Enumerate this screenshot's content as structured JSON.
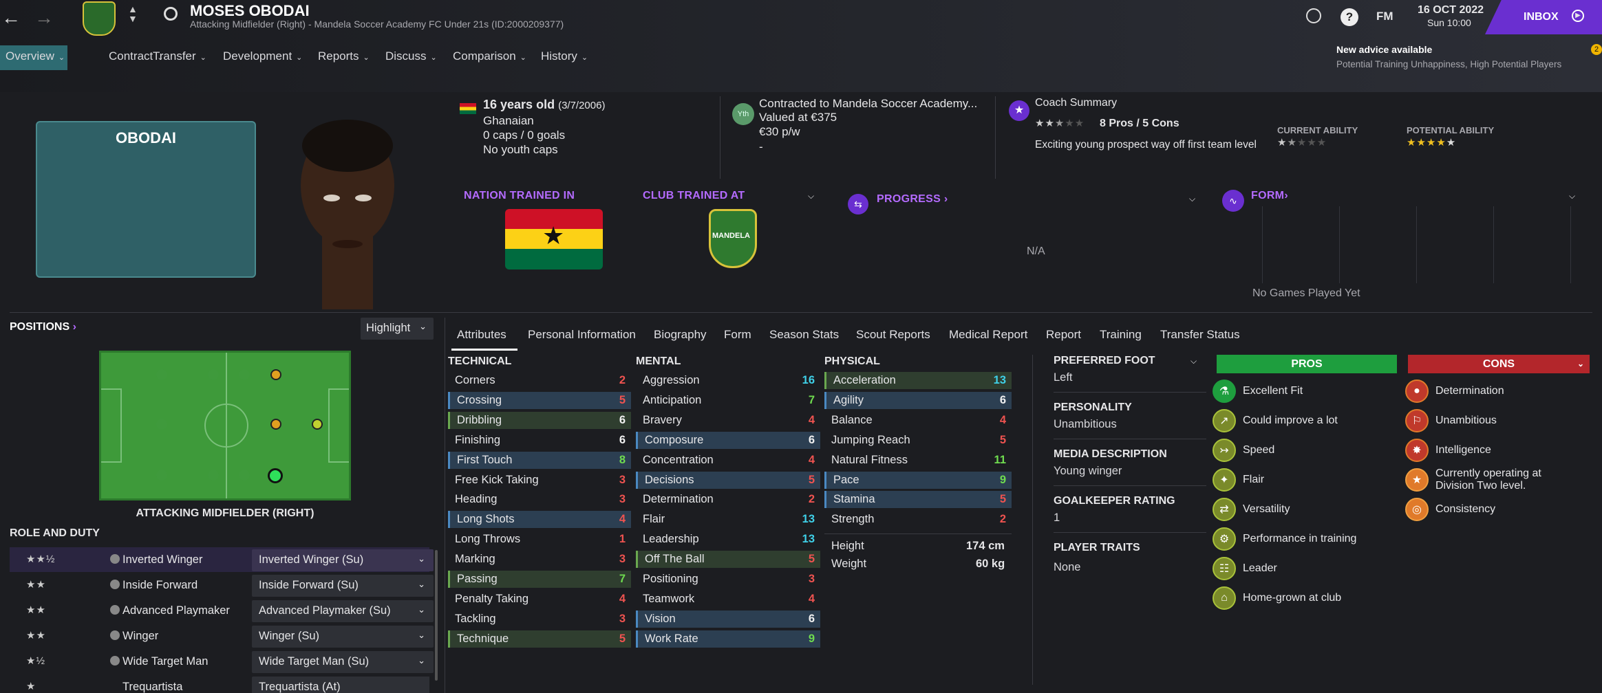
{
  "header": {
    "player_name": "MOSES OBODAI",
    "player_subtitle": "Attacking Midfielder (Right) - Mandela Soccer Academy FC Under 21s (ID:2000209377)",
    "date": "16 OCT 2022",
    "time": "Sun 10:00",
    "fm_label": "FM",
    "inbox_label": "INBOX",
    "inbox_count": "2",
    "advice_title": "New advice available",
    "advice_text": "Potential Training Unhappiness, High Potential Players"
  },
  "nav_tabs": [
    "Overview",
    "Contract",
    "Transfer",
    "Development",
    "Reports",
    "Discuss",
    "Comparison",
    "History"
  ],
  "profile": {
    "kit_name": "OBODAI",
    "age": "16 years old",
    "dob": "(3/7/2006)",
    "nationality": "Ghanaian",
    "caps": "0 caps / 0 goals",
    "youth_caps": "No youth caps",
    "yth_badge": "Yth",
    "contract": "Contracted to Mandela Soccer Academy...",
    "value": "Valued at €375",
    "wage": "€30 p/w",
    "contract_extra": "-",
    "coach_title": "Coach Summary",
    "pros_cons_summary": "8 Pros / 5 Cons",
    "coach_text": "Exciting young prospect way off first team level",
    "current_ability_label": "CURRENT ABILITY",
    "potential_ability_label": "POTENTIAL ABILITY",
    "current_ability_stars": 1.5,
    "potential_ability_stars": 4,
    "coach_stars": 2.5,
    "nation_trained_label": "NATION TRAINED IN",
    "club_trained_label": "CLUB TRAINED AT",
    "progress_label": "PROGRESS",
    "progress_value": "N/A",
    "form_label": "FORM",
    "form_empty": "No Games Played Yet",
    "club_badge_text": "MANDELA"
  },
  "positions": {
    "title": "POSITIONS",
    "highlight_label": "Highlight",
    "position_name": "ATTACKING MIDFIELDER (RIGHT)"
  },
  "roles": {
    "title": "ROLE AND DUTY",
    "items": [
      {
        "name": "Inverted Winger",
        "duty": "Inverted Winger (Su)",
        "stars": "★★½"
      },
      {
        "name": "Inside Forward",
        "duty": "Inside Forward (Su)",
        "stars": "★★"
      },
      {
        "name": "Advanced Playmaker",
        "duty": "Advanced Playmaker (Su)",
        "stars": "★★"
      },
      {
        "name": "Winger",
        "duty": "Winger (Su)",
        "stars": "★★"
      },
      {
        "name": "Wide Target Man",
        "duty": "Wide Target Man (Su)",
        "stars": "★½"
      },
      {
        "name": "Trequartista",
        "duty": "Trequartista (At)",
        "stars": "★"
      }
    ]
  },
  "sub_tabs": [
    "Attributes",
    "Personal Information",
    "Biography",
    "Form",
    "Season Stats",
    "Scout Reports",
    "Medical Report",
    "Report",
    "Training",
    "Transfer Status"
  ],
  "attributes": {
    "technical_title": "TECHNICAL",
    "mental_title": "MENTAL",
    "physical_title": "PHYSICAL",
    "technical": [
      {
        "name": "Corners",
        "value": "2"
      },
      {
        "name": "Crossing",
        "value": "5"
      },
      {
        "name": "Dribbling",
        "value": "6"
      },
      {
        "name": "Finishing",
        "value": "6"
      },
      {
        "name": "First Touch",
        "value": "8"
      },
      {
        "name": "Free Kick Taking",
        "value": "3"
      },
      {
        "name": "Heading",
        "value": "3"
      },
      {
        "name": "Long Shots",
        "value": "4"
      },
      {
        "name": "Long Throws",
        "value": "1"
      },
      {
        "name": "Marking",
        "value": "3"
      },
      {
        "name": "Passing",
        "value": "7"
      },
      {
        "name": "Penalty Taking",
        "value": "4"
      },
      {
        "name": "Tackling",
        "value": "3"
      },
      {
        "name": "Technique",
        "value": "5"
      }
    ],
    "mental": [
      {
        "name": "Aggression",
        "value": "16"
      },
      {
        "name": "Anticipation",
        "value": "7"
      },
      {
        "name": "Bravery",
        "value": "4"
      },
      {
        "name": "Composure",
        "value": "6"
      },
      {
        "name": "Concentration",
        "value": "4"
      },
      {
        "name": "Decisions",
        "value": "5"
      },
      {
        "name": "Determination",
        "value": "2"
      },
      {
        "name": "Flair",
        "value": "13"
      },
      {
        "name": "Leadership",
        "value": "13"
      },
      {
        "name": "Off The Ball",
        "value": "5"
      },
      {
        "name": "Positioning",
        "value": "3"
      },
      {
        "name": "Teamwork",
        "value": "4"
      },
      {
        "name": "Vision",
        "value": "6"
      },
      {
        "name": "Work Rate",
        "value": "9"
      }
    ],
    "physical": [
      {
        "name": "Acceleration",
        "value": "13"
      },
      {
        "name": "Agility",
        "value": "6"
      },
      {
        "name": "Balance",
        "value": "4"
      },
      {
        "name": "Jumping Reach",
        "value": "5"
      },
      {
        "name": "Natural Fitness",
        "value": "11"
      },
      {
        "name": "Pace",
        "value": "9"
      },
      {
        "name": "Stamina",
        "value": "5"
      },
      {
        "name": "Strength",
        "value": "2"
      }
    ],
    "height_label": "Height",
    "height": "174 cm",
    "weight_label": "Weight",
    "weight": "60 kg"
  },
  "info": {
    "preferred_foot_label": "PREFERRED FOOT",
    "preferred_foot": "Left",
    "personality_label": "PERSONALITY",
    "personality": "Unambitious",
    "media_label": "MEDIA DESCRIPTION",
    "media": "Young winger",
    "gk_label": "GOALKEEPER RATING",
    "gk": "1",
    "traits_label": "PLAYER TRAITS",
    "traits": "None"
  },
  "pros": {
    "title": "PROS",
    "items": [
      "Excellent Fit",
      "Could improve a lot",
      "Speed",
      "Flair",
      "Versatility",
      "Performance in training",
      "Leader",
      "Home-grown at club"
    ]
  },
  "cons": {
    "title": "CONS",
    "items": [
      "Determination",
      "Unambitious",
      "Intelligence",
      "Currently operating at Division Two level.",
      "Consistency"
    ]
  },
  "colors": {
    "accent": "#b46bff",
    "pros": "#1e9e3e",
    "cons": "#b3262b",
    "inbox": "#6a2fd0",
    "pitch": "#3f9a3c"
  }
}
